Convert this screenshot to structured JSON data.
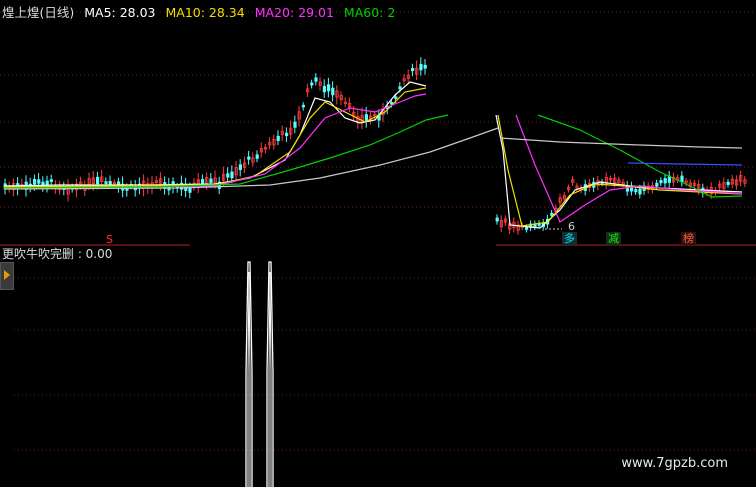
{
  "title_line": {
    "name": "煌上煌(日线)",
    "ma": [
      {
        "label": "MA5: 28.03",
        "color": "#ffffff"
      },
      {
        "label": "MA10: 28.34",
        "color": "#f0e000"
      },
      {
        "label": "MA20: 29.01",
        "color": "#ff30ff"
      },
      {
        "label": "MA60: 2",
        "color": "#00d000"
      }
    ]
  },
  "indicator": {
    "label": "更吹牛吹完删 : 0.00"
  },
  "signals": [
    {
      "text": "S",
      "color": "#ff3030"
    },
    {
      "text": "多",
      "color": "#00e0ff"
    },
    {
      "text": "减",
      "color": "#20e020"
    },
    {
      "text": "榜",
      "color": "#ff6040"
    }
  ],
  "low_marker": "6",
  "watermark": "www.7gpzb.com",
  "colors": {
    "up": "#ff3c3c",
    "down": "#54ffff",
    "ma5": "#ffffff",
    "ma10": "#f0e000",
    "ma20": "#ff30ff",
    "ma60": "#00d000",
    "ma_long": "#c8c8c8",
    "ma_blue": "#3050ff"
  }
}
